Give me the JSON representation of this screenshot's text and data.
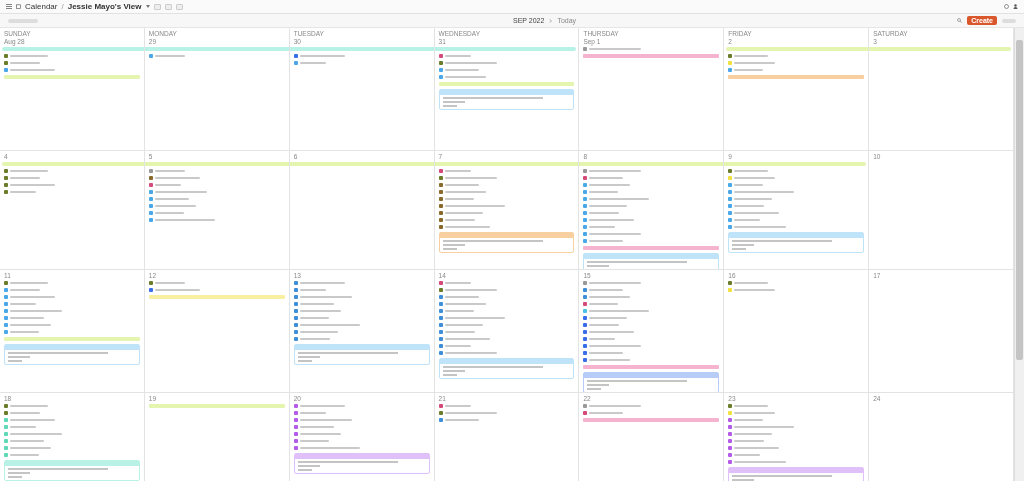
{
  "top_bar": {
    "app": "Calendar",
    "separator": "/",
    "view": "Jessie Mayo's View"
  },
  "toolbar": {
    "month": "SEP 2022",
    "today": "Today",
    "create": "Create"
  },
  "weekdays": [
    "SUNDAY",
    "MONDAY",
    "TUESDAY",
    "WEDNESDAY",
    "THURSDAY",
    "FRIDAY",
    "SATURDAY"
  ],
  "weeks": [
    {
      "days": [
        {
          "date": "Aug 28",
          "band": {
            "color": "#b8f2e6",
            "continues_left": false,
            "continues_right": true
          },
          "items": [
            {
              "kind": "task",
              "color": "#6b7d2a"
            },
            {
              "kind": "task",
              "color": "#6b7d2a"
            },
            {
              "kind": "task",
              "color": "#4aa8e8"
            },
            {
              "kind": "bar",
              "color": "#e4f5b0"
            }
          ]
        },
        {
          "date": "29",
          "band": {
            "color": "#b8f2e6",
            "continues_left": true,
            "continues_right": true
          },
          "items": [
            {
              "kind": "task",
              "color": "#4aa8e8"
            }
          ]
        },
        {
          "date": "30",
          "band": {
            "color": "#b8f2e6",
            "continues_left": true,
            "continues_right": true
          },
          "items": [
            {
              "kind": "task",
              "color": "#3a6ee8"
            },
            {
              "kind": "task",
              "color": "#4aa8e8"
            }
          ]
        },
        {
          "date": "31",
          "band": {
            "color": "#b8f2e6",
            "continues_left": true,
            "continues_right": false
          },
          "items": [
            {
              "kind": "task",
              "color": "#d44a7a"
            },
            {
              "kind": "task",
              "color": "#6b7d2a"
            },
            {
              "kind": "task",
              "color": "#4aa8e8"
            },
            {
              "kind": "task",
              "color": "#4aa8e8"
            },
            {
              "kind": "bar",
              "color": "#e4f5b0"
            },
            {
              "kind": "card",
              "color": "#bfe3f8"
            }
          ]
        },
        {
          "date": "Sep 1",
          "items": [
            {
              "kind": "task",
              "color": "#999999"
            },
            {
              "kind": "bar",
              "color": "#f5b3d0"
            }
          ]
        },
        {
          "date": "2",
          "band": {
            "color": "#e4f5b0",
            "continues_left": false,
            "continues_right": true
          },
          "items": [
            {
              "kind": "task",
              "color": "#6b7d2a"
            },
            {
              "kind": "task",
              "color": "#f0e040"
            },
            {
              "kind": "task",
              "color": "#4aa8e8"
            },
            {
              "kind": "bar",
              "color": "#f8d0a0"
            }
          ]
        },
        {
          "date": "3",
          "band": {
            "color": "#e4f5b0",
            "continues_left": true,
            "continues_right": false
          }
        }
      ]
    },
    {
      "days": [
        {
          "date": "4",
          "band": {
            "color": "#e4f5b0",
            "continues_left": false,
            "continues_right": true
          },
          "items": [
            {
              "kind": "task",
              "color": "#6b7d2a"
            },
            {
              "kind": "task",
              "color": "#6b7d2a"
            },
            {
              "kind": "task",
              "color": "#6b7d2a"
            },
            {
              "kind": "task",
              "color": "#6b7d2a"
            }
          ]
        },
        {
          "date": "5",
          "band": {
            "color": "#e4f5b0",
            "continues_left": true,
            "continues_right": true
          },
          "items": [
            {
              "kind": "task",
              "color": "#999999"
            },
            {
              "kind": "task",
              "color": "#8a6a2a"
            },
            {
              "kind": "task",
              "color": "#d44a7a"
            },
            {
              "kind": "task",
              "color": "#4aa8e8"
            },
            {
              "kind": "task",
              "color": "#4aa8e8"
            },
            {
              "kind": "task",
              "color": "#4aa8e8"
            },
            {
              "kind": "task",
              "color": "#4aa8e8"
            },
            {
              "kind": "task",
              "color": "#4aa8e8"
            }
          ]
        },
        {
          "date": "6",
          "band": {
            "color": "#e4f5b0",
            "continues_left": true,
            "continues_right": true
          }
        },
        {
          "date": "7",
          "band": {
            "color": "#e4f5b0",
            "continues_left": true,
            "continues_right": true
          },
          "items": [
            {
              "kind": "task",
              "color": "#d44a7a"
            },
            {
              "kind": "task",
              "color": "#6b7d2a"
            },
            {
              "kind": "task",
              "color": "#8a6a2a"
            },
            {
              "kind": "task",
              "color": "#8a6a2a"
            },
            {
              "kind": "task",
              "color": "#8a6a2a"
            },
            {
              "kind": "task",
              "color": "#8a6a2a"
            },
            {
              "kind": "task",
              "color": "#8a6a2a"
            },
            {
              "kind": "task",
              "color": "#8a6a2a"
            },
            {
              "kind": "task",
              "color": "#8a6a2a"
            },
            {
              "kind": "card",
              "color": "#f8d0a0"
            }
          ]
        },
        {
          "date": "8",
          "band": {
            "color": "#e4f5b0",
            "continues_left": true,
            "continues_right": true
          },
          "items": [
            {
              "kind": "task",
              "color": "#999999"
            },
            {
              "kind": "task",
              "color": "#d44a7a"
            },
            {
              "kind": "task",
              "color": "#4aa8e8"
            },
            {
              "kind": "task",
              "color": "#4aa8e8"
            },
            {
              "kind": "task",
              "color": "#4aa8e8"
            },
            {
              "kind": "task",
              "color": "#4aa8e8"
            },
            {
              "kind": "task",
              "color": "#4aa8e8"
            },
            {
              "kind": "task",
              "color": "#4aa8e8"
            },
            {
              "kind": "task",
              "color": "#4aa8e8"
            },
            {
              "kind": "task",
              "color": "#4aa8e8"
            },
            {
              "kind": "task",
              "color": "#4aa8e8"
            },
            {
              "kind": "bar",
              "color": "#f5b3d0"
            },
            {
              "kind": "card",
              "color": "#bfe3f8"
            }
          ]
        },
        {
          "date": "9",
          "band": {
            "color": "#e4f5b0",
            "continues_left": true,
            "continues_right": false
          },
          "items": [
            {
              "kind": "task",
              "color": "#6b7d2a"
            },
            {
              "kind": "task",
              "color": "#f0e040"
            },
            {
              "kind": "task",
              "color": "#4aa8e8"
            },
            {
              "kind": "task",
              "color": "#4aa8e8"
            },
            {
              "kind": "task",
              "color": "#4aa8e8"
            },
            {
              "kind": "task",
              "color": "#4aa8e8"
            },
            {
              "kind": "task",
              "color": "#4aa8e8"
            },
            {
              "kind": "task",
              "color": "#4aa8e8"
            },
            {
              "kind": "task",
              "color": "#4aa8e8"
            },
            {
              "kind": "card",
              "color": "#bfe3f8"
            }
          ]
        },
        {
          "date": "10"
        }
      ]
    },
    {
      "days": [
        {
          "date": "11",
          "items": [
            {
              "kind": "task",
              "color": "#6b7d2a"
            },
            {
              "kind": "task",
              "color": "#4aa8e8"
            },
            {
              "kind": "task",
              "color": "#4aa8e8"
            },
            {
              "kind": "task",
              "color": "#4aa8e8"
            },
            {
              "kind": "task",
              "color": "#4aa8e8"
            },
            {
              "kind": "task",
              "color": "#4aa8e8"
            },
            {
              "kind": "task",
              "color": "#4aa8e8"
            },
            {
              "kind": "task",
              "color": "#4aa8e8"
            },
            {
              "kind": "bar",
              "color": "#e4f5b0"
            },
            {
              "kind": "card",
              "color": "#bfe3f8"
            }
          ]
        },
        {
          "date": "12",
          "items": [
            {
              "kind": "task",
              "color": "#6b7d2a"
            },
            {
              "kind": "task",
              "color": "#3a6ee8"
            },
            {
              "kind": "bar",
              "color": "#f8f0a0"
            }
          ]
        },
        {
          "date": "13",
          "items": [
            {
              "kind": "task",
              "color": "#3f8fd8"
            },
            {
              "kind": "task",
              "color": "#3f8fd8"
            },
            {
              "kind": "task",
              "color": "#3f8fd8"
            },
            {
              "kind": "task",
              "color": "#3f8fd8"
            },
            {
              "kind": "task",
              "color": "#3f8fd8"
            },
            {
              "kind": "task",
              "color": "#3f8fd8"
            },
            {
              "kind": "task",
              "color": "#3f8fd8"
            },
            {
              "kind": "task",
              "color": "#3f8fd8"
            },
            {
              "kind": "task",
              "color": "#3f8fd8"
            },
            {
              "kind": "card",
              "color": "#bfe3f8"
            }
          ]
        },
        {
          "date": "14",
          "items": [
            {
              "kind": "task",
              "color": "#d44a7a"
            },
            {
              "kind": "task",
              "color": "#6b7d2a"
            },
            {
              "kind": "task",
              "color": "#3f8fd8"
            },
            {
              "kind": "task",
              "color": "#3f8fd8"
            },
            {
              "kind": "task",
              "color": "#3f8fd8"
            },
            {
              "kind": "task",
              "color": "#3f8fd8"
            },
            {
              "kind": "task",
              "color": "#3f8fd8"
            },
            {
              "kind": "task",
              "color": "#3f8fd8"
            },
            {
              "kind": "task",
              "color": "#3f8fd8"
            },
            {
              "kind": "task",
              "color": "#3f8fd8"
            },
            {
              "kind": "task",
              "color": "#3f8fd8"
            },
            {
              "kind": "card",
              "color": "#bfe3f8"
            }
          ]
        },
        {
          "date": "15",
          "items": [
            {
              "kind": "task",
              "color": "#999999"
            },
            {
              "kind": "task",
              "color": "#3f8fd8"
            },
            {
              "kind": "task",
              "color": "#3f8fd8"
            },
            {
              "kind": "task",
              "color": "#d44a7a"
            },
            {
              "kind": "task",
              "color": "#4ac0e8"
            },
            {
              "kind": "task",
              "color": "#3a6ee8"
            },
            {
              "kind": "task",
              "color": "#3a6ee8"
            },
            {
              "kind": "task",
              "color": "#3a6ee8"
            },
            {
              "kind": "task",
              "color": "#3a6ee8"
            },
            {
              "kind": "task",
              "color": "#3a6ee8"
            },
            {
              "kind": "task",
              "color": "#3a6ee8"
            },
            {
              "kind": "task",
              "color": "#3a6ee8"
            },
            {
              "kind": "bar",
              "color": "#f5b3d0"
            },
            {
              "kind": "card",
              "color": "#b8ccf8"
            }
          ]
        },
        {
          "date": "16",
          "items": [
            {
              "kind": "task",
              "color": "#6b7d2a"
            },
            {
              "kind": "task",
              "color": "#f0e040"
            }
          ]
        },
        {
          "date": "17"
        }
      ]
    },
    {
      "days": [
        {
          "date": "18",
          "items": [
            {
              "kind": "task",
              "color": "#6b7d2a"
            },
            {
              "kind": "task",
              "color": "#6b7d2a"
            },
            {
              "kind": "task",
              "color": "#5fd8b8"
            },
            {
              "kind": "task",
              "color": "#5fd8b8"
            },
            {
              "kind": "task",
              "color": "#5fd8b8"
            },
            {
              "kind": "task",
              "color": "#5fd8b8"
            },
            {
              "kind": "task",
              "color": "#5fd8b8"
            },
            {
              "kind": "task",
              "color": "#5fd8b8"
            },
            {
              "kind": "card",
              "color": "#b8f2e6"
            }
          ]
        },
        {
          "date": "19",
          "items": [
            {
              "kind": "bar",
              "color": "#e4f5b0"
            }
          ]
        },
        {
          "date": "20",
          "items": [
            {
              "kind": "task",
              "color": "#b45ce8"
            },
            {
              "kind": "task",
              "color": "#b45ce8"
            },
            {
              "kind": "task",
              "color": "#b45ce8"
            },
            {
              "kind": "task",
              "color": "#b45ce8"
            },
            {
              "kind": "task",
              "color": "#b45ce8"
            },
            {
              "kind": "task",
              "color": "#b45ce8"
            },
            {
              "kind": "task",
              "color": "#b45ce8"
            },
            {
              "kind": "card",
              "color": "#e0c0f8"
            }
          ]
        },
        {
          "date": "21",
          "items": [
            {
              "kind": "task",
              "color": "#d44a7a"
            },
            {
              "kind": "task",
              "color": "#6b7d2a"
            },
            {
              "kind": "task",
              "color": "#3f8fd8"
            }
          ]
        },
        {
          "date": "22",
          "items": [
            {
              "kind": "task",
              "color": "#999999"
            },
            {
              "kind": "task",
              "color": "#d44a7a"
            },
            {
              "kind": "bar",
              "color": "#f5b3d0"
            }
          ]
        },
        {
          "date": "23",
          "items": [
            {
              "kind": "task",
              "color": "#6b7d2a"
            },
            {
              "kind": "task",
              "color": "#f0e040"
            },
            {
              "kind": "task",
              "color": "#b45ce8"
            },
            {
              "kind": "task",
              "color": "#b45ce8"
            },
            {
              "kind": "task",
              "color": "#b45ce8"
            },
            {
              "kind": "task",
              "color": "#b45ce8"
            },
            {
              "kind": "task",
              "color": "#b45ce8"
            },
            {
              "kind": "task",
              "color": "#b45ce8"
            },
            {
              "kind": "task",
              "color": "#b45ce8"
            },
            {
              "kind": "card",
              "color": "#e0c0f8"
            }
          ]
        },
        {
          "date": "24"
        }
      ]
    }
  ]
}
